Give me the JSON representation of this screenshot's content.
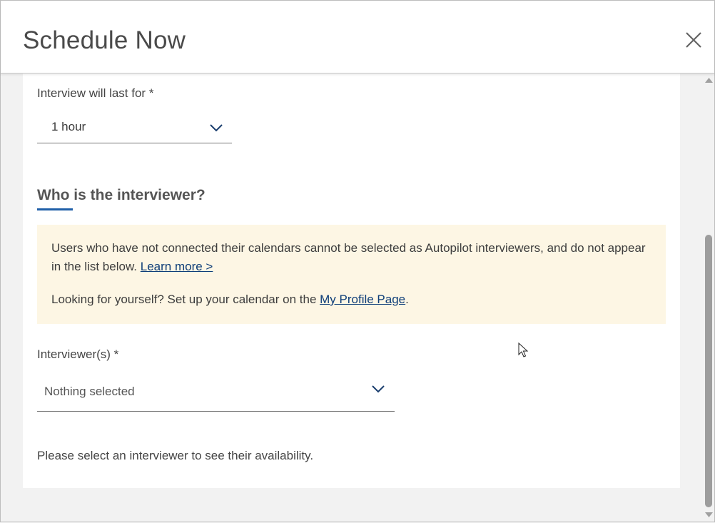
{
  "dialog": {
    "title": "Schedule Now",
    "close_icon": "close-icon"
  },
  "duration": {
    "label": "Interview will last for *",
    "selected": "1 hour",
    "icon": "chevron-down-icon"
  },
  "interviewer_section": {
    "heading": "Who is the interviewer?",
    "accent_color": "#1f5fa8"
  },
  "notice": {
    "text": "Users who have not connected their calendars cannot be selected as Autopilot interviewers, and do not appear in the list below.",
    "learn_more": "Learn more >",
    "prompt": "Looking for yourself? Set up your calendar on the",
    "profile_link": "My Profile Page",
    "suffix": ".",
    "background": "#fdf6e4"
  },
  "interviewers": {
    "label": "Interviewer(s) *",
    "placeholder": "Nothing selected",
    "icon": "chevron-down-icon"
  },
  "availability_hint": "Please select an interviewer to see their availability."
}
